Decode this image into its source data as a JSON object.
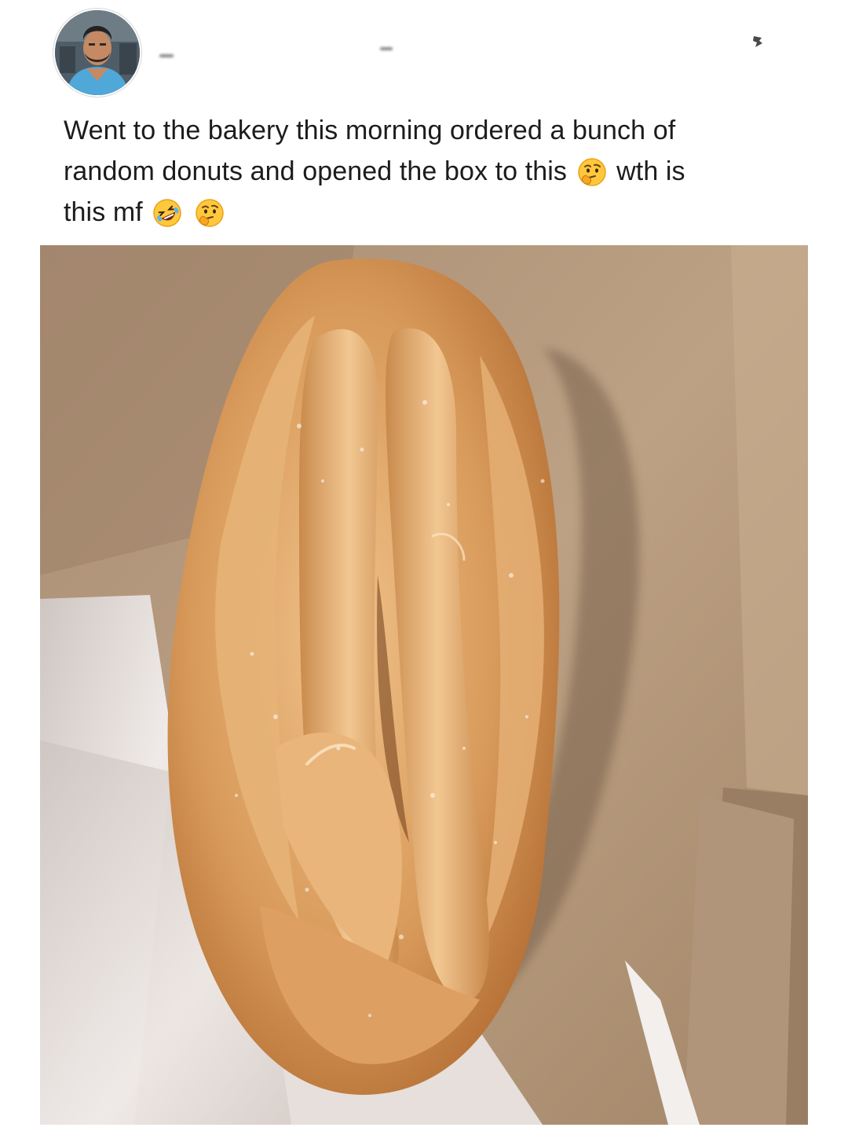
{
  "post": {
    "author_avatar": "profile-photo",
    "text_line_1": "Went to the bakery this morning ordered a bunch of",
    "text_line_2_part_1": "random donuts and opened the box to this",
    "text_line_2_part_2": "wth is",
    "text_line_3": "this mf",
    "emoji_1": "thinking-face-emoji",
    "emoji_2": "rolling-on-floor-laughing-emoji",
    "emoji_3": "thinking-face-emoji"
  },
  "photo": {
    "subject": "glazed-donut-in-box"
  },
  "colors": {
    "box_cardboard": "#b89a7e",
    "glaze": "#d9a46a",
    "paper": "#e8e3e0"
  }
}
